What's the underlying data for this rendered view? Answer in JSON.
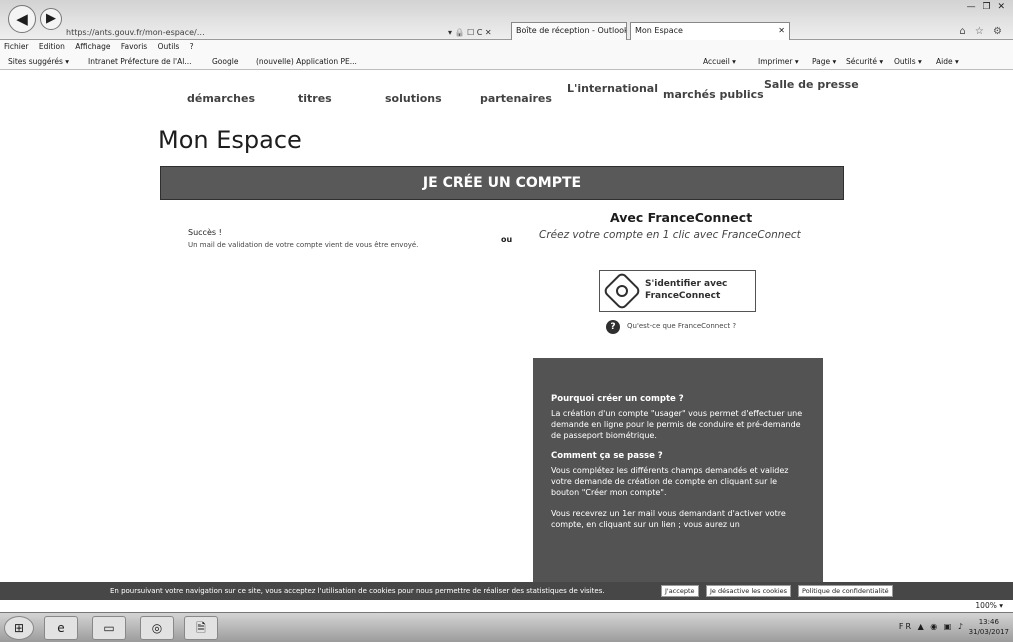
{
  "browser": {
    "address": "https://ants.gouv.fr/mon-espace/…",
    "address_icons": "▾ 🔒 ☐ C ✕",
    "tabs": [
      {
        "label": "Boîte de réception - Outlook"
      },
      {
        "label": "Mon Espace"
      }
    ],
    "tab_close": "✕",
    "window_controls": "— ❐ ✕",
    "chrome_icons": "⌂ ☆ ⚙"
  },
  "menubar": [
    "Fichier",
    "Edition",
    "Affichage",
    "Favoris",
    "Outils",
    "?"
  ],
  "favorites": {
    "items": [
      "Sites suggérés ▾",
      "Intranet Préfecture de l'Al...",
      "Google",
      "(nouvelle) Application PE..."
    ],
    "commands": [
      "Accueil ▾",
      "Imprimer ▾",
      "Page ▾",
      "Sécurité ▾",
      "Outils ▾",
      "Aide ▾"
    ]
  },
  "site_nav": [
    "démarches",
    "titres",
    "solutions",
    "partenaires",
    "L'international",
    "marchés publics",
    "Salle de presse"
  ],
  "page": {
    "title": "Mon Espace",
    "create_account": "JE CRÉE UN COMPTE",
    "success_title": "Succès !",
    "success_message": "Un mail de validation de votre compte vient de vous être envoyé.",
    "or": "ou"
  },
  "franceconnect": {
    "title": "Avec FranceConnect",
    "subtitle": "Créez votre compte en 1 clic avec FranceConnect",
    "button_line1": "S'identifier avec",
    "button_line2": "FranceConnect",
    "help_icon": "?",
    "help_link": "Qu'est-ce que FranceConnect ?"
  },
  "why": {
    "heading1": "Pourquoi créer un compte ?",
    "text1": "La création d'un compte \"usager\" vous permet d'effectuer une demande en ligne pour le permis de conduire et pré-demande de passeport biométrique.",
    "heading2": "Comment ça se passe ?",
    "text2": "Vous complétez les différents champs demandés et validez votre demande de création de compte en cliquant sur le bouton \"Créer mon compte\".",
    "text3": "Vous recevrez un 1er mail vous demandant d'activer votre compte, en cliquant sur un lien ; vous aurez un"
  },
  "cookie": {
    "text": "En poursuivant votre navigation sur ce site, vous acceptez l'utilisation de cookies pour nous permettre de réaliser des statistiques de visites.",
    "accept": "J'accepte",
    "refuse": "Je désactive les cookies",
    "more": "Politique de confidentialité"
  },
  "zoom": "100% ▾",
  "taskbar": {
    "items": [
      "⊞",
      "e",
      "▭",
      "◎",
      "🗎"
    ],
    "tray": "FR ▲ ◉ ▣ ♪",
    "time": "13:46",
    "date": "31/03/2017"
  }
}
